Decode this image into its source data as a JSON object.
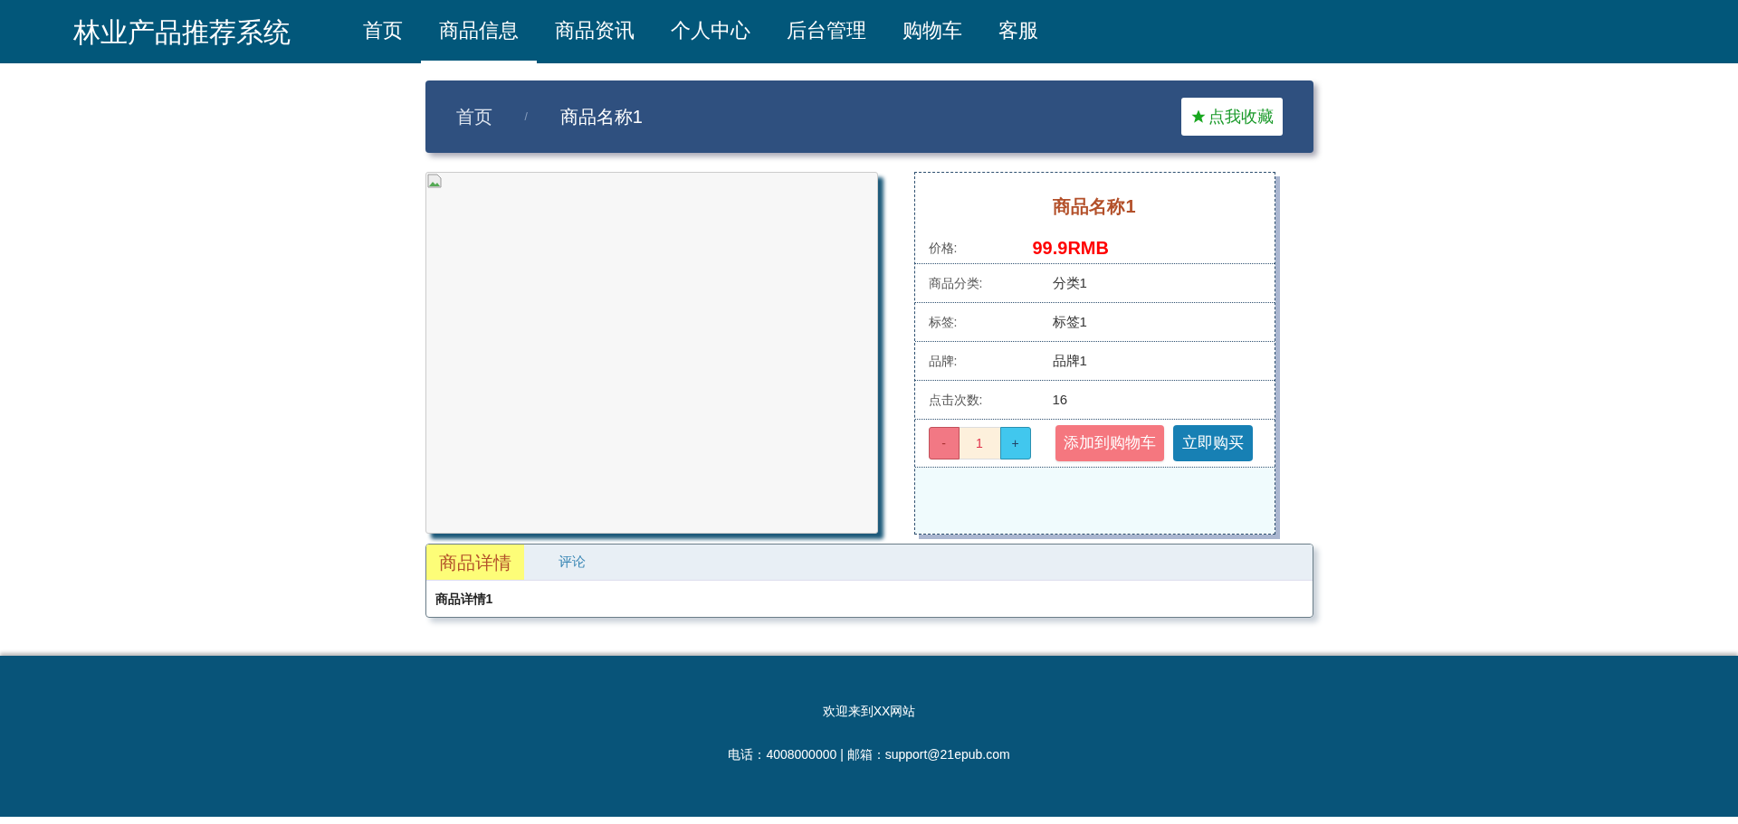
{
  "header": {
    "logo": "林业产品推荐系统",
    "nav": [
      {
        "label": "首页",
        "selected": false
      },
      {
        "label": "商品信息",
        "selected": true
      },
      {
        "label": "商品资讯",
        "selected": false
      },
      {
        "label": "个人中心",
        "selected": false
      },
      {
        "label": "后台管理",
        "selected": false
      },
      {
        "label": "购物车",
        "selected": false
      },
      {
        "label": "客服",
        "selected": false
      }
    ]
  },
  "breadcrumb": {
    "items": [
      "首页",
      "商品名称1"
    ],
    "separator": "/",
    "favorite": "点我收藏"
  },
  "product": {
    "name": "商品名称1",
    "price_label": "价格:",
    "price": "99.9RMB",
    "fields": [
      {
        "label": "商品分类:",
        "value": "分类1"
      },
      {
        "label": "标签:",
        "value": "标签1"
      },
      {
        "label": "品牌:",
        "value": "品牌1"
      },
      {
        "label": "点击次数:",
        "value": "16"
      }
    ],
    "quantity": {
      "minus": "-",
      "value": "1",
      "plus": "+"
    },
    "add_to_cart": "添加到购物车",
    "buy_now": "立即购买"
  },
  "tabs": [
    {
      "label": "商品详情",
      "selected": true
    },
    {
      "label": "评论",
      "selected": false
    }
  ],
  "detail": "商品详情1",
  "footer": {
    "lines": [
      "欢迎来到XX网站",
      "电话：4008000000 | 邮箱：support@21epub.com"
    ]
  }
}
